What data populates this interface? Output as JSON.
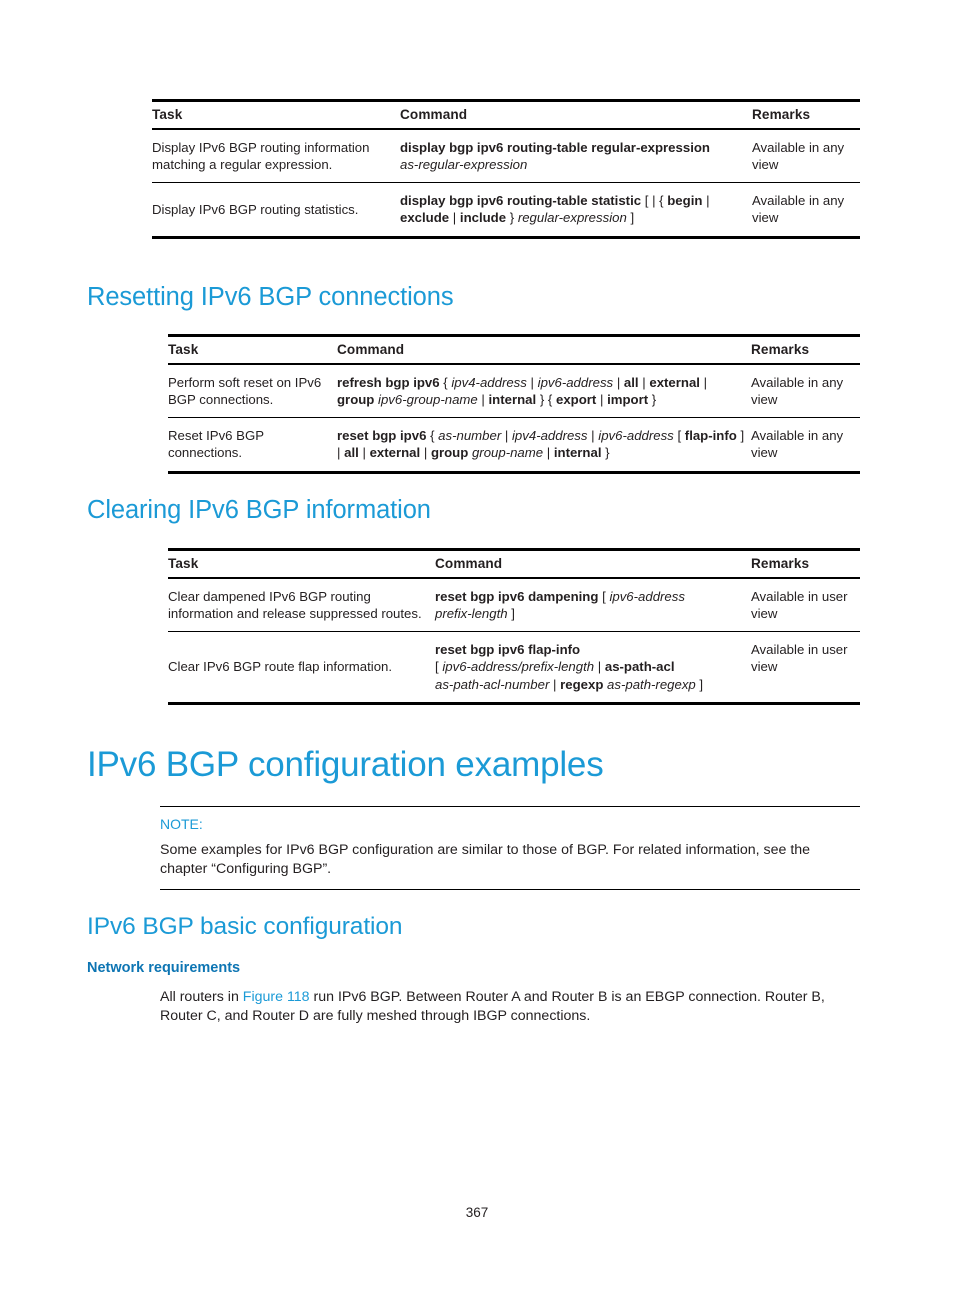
{
  "page": {
    "number": "367",
    "accent_color": "#1b9ad6",
    "heading_color_bold": "#0d75b3",
    "text_color": "#231f20"
  },
  "table_display": {
    "name": "display-ipv6-bgp-table",
    "columns": [
      "Task",
      "Command",
      "Remarks"
    ],
    "rows": [
      {
        "task": "Display IPv6 BGP routing information matching a regular expression.",
        "command_bold_1": "display bgp ipv6 routing-table regular-expression",
        "command_italic_1": "as-regular-expression",
        "remarks": "Available in any view"
      },
      {
        "task": "Display IPv6 BGP routing statistics.",
        "command_bold_1": "display bgp ipv6 routing-table statistic",
        "command_plain_1": "[ | {",
        "command_bold_2": "begin",
        "command_sep_1": "|",
        "command_bold_3": "exclude",
        "command_sep_2": "|",
        "command_bold_4": "include",
        "command_plain_2": "}",
        "command_italic_1": "regular-expression",
        "command_plain_3": "]",
        "remarks": "Available in any view"
      }
    ]
  },
  "section_resetting": {
    "heading": "Resetting IPv6 BGP connections",
    "table": {
      "name": "resetting-ipv6-bgp-table",
      "columns": [
        "Task",
        "Command",
        "Remarks"
      ],
      "rows": [
        {
          "task": "Perform soft reset on IPv6 BGP connections.",
          "command_bold_1": "refresh bgp ipv6",
          "command_plain_1": "{",
          "command_italic_1": "ipv4-address",
          "command_sep_1": "|",
          "command_italic_2": "ipv6-address",
          "command_sep_2": "|",
          "command_bold_2": "all",
          "command_sep_3": "|",
          "command_bold_3": "external",
          "command_sep_4": "|",
          "command_bold_4": "group",
          "command_italic_3": "ipv6-group-name",
          "command_sep_5": "|",
          "command_bold_5": "internal",
          "command_plain_2": "} {",
          "command_bold_6": "export",
          "command_sep_6": "|",
          "command_bold_7": "import",
          "command_plain_3": "}",
          "remarks": "Available in any view"
        },
        {
          "task": "Reset IPv6 BGP connections.",
          "command_bold_1": "reset bgp ipv6",
          "command_plain_1": "{",
          "command_italic_1": "as-number",
          "command_sep_1": "|",
          "command_italic_2": "ipv4-address",
          "command_sep_2": "|",
          "command_italic_3": "ipv6-address",
          "command_plain_2": "[",
          "command_bold_2": "flap-info",
          "command_plain_3": "] |",
          "command_bold_3": "all",
          "command_sep_3": "|",
          "command_bold_4": "external",
          "command_sep_4": "|",
          "command_bold_5": "group",
          "command_italic_4": "group-name",
          "command_sep_5": "|",
          "command_bold_6": "internal",
          "command_plain_4": "}",
          "remarks": "Available in any view"
        }
      ]
    }
  },
  "section_clearing": {
    "heading": "Clearing IPv6 BGP information",
    "table": {
      "name": "clearing-ipv6-bgp-table",
      "columns": [
        "Task",
        "Command",
        "Remarks"
      ],
      "rows": [
        {
          "task": "Clear dampened IPv6 BGP routing information and release suppressed routes.",
          "command_bold_1": "reset bgp ipv6 dampening",
          "command_plain_1": "[",
          "command_italic_1": "ipv6-address",
          "command_italic_2": "prefix-length",
          "command_plain_2": "]",
          "remarks": "Available in user view"
        },
        {
          "task": "Clear IPv6 BGP route flap information.",
          "command_bold_1": "reset bgp ipv6 flap-info",
          "command_plain_1": "[",
          "command_italic_1": "ipv6-address/prefix-length",
          "command_sep_1": "|",
          "command_bold_2": "as-path-acl",
          "command_italic_2": "as-path-acl-number",
          "command_sep_2": "|",
          "command_bold_3": "regexp",
          "command_italic_3": "as-path-regexp",
          "command_plain_2": "]",
          "remarks": "Available in user view"
        }
      ]
    }
  },
  "section_examples": {
    "heading": "IPv6 BGP configuration examples",
    "note": {
      "label": "NOTE:",
      "body": "Some examples for IPv6 BGP configuration are similar to those of BGP. For related information, see the chapter “Configuring BGP”."
    }
  },
  "section_basic": {
    "heading": "IPv6 BGP basic configuration",
    "subheading": "Network requirements",
    "paragraph": {
      "part_1": "All routers in ",
      "link": "Figure 118",
      "part_2": " run IPv6 BGP. Between Router A and Router B is an EBGP connection. Router B, Router C, and Router D are fully meshed through IBGP connections."
    }
  }
}
